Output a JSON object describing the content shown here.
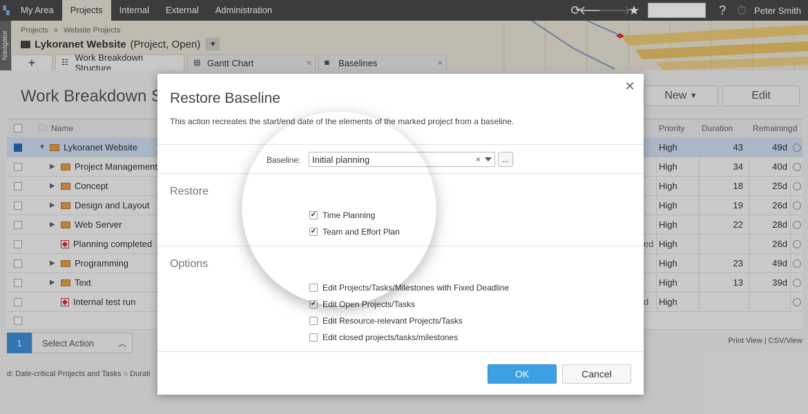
{
  "topnav": {
    "tabs": [
      "My Area",
      "Projects",
      "Internal",
      "External",
      "Administration"
    ],
    "active_tab": "Projects",
    "user": "Peter Smith",
    "icons": [
      "refresh-icon",
      "back-icon",
      "forward-icon",
      "star-icon",
      "help-icon",
      "timer-icon"
    ]
  },
  "project": {
    "navigator_label": "Navigator",
    "breadcrumb": [
      "Projects",
      "»",
      "Website Projects"
    ],
    "name": "Lykoranet Website",
    "status": "(Project, Open)",
    "view_tabs": [
      "Work Breakdown Structure",
      "Gantt Chart",
      "Baselines"
    ]
  },
  "page": {
    "title": "Work Breakdown S",
    "new_button": "New",
    "edit_button": "Edit",
    "columns": {
      "name": "Name",
      "priority": "Priority",
      "duration": "Duration",
      "remaining": "Remaining",
      "d": "d"
    },
    "rows": [
      {
        "name": "Lykoranet Website",
        "kind": "folder",
        "level": 0,
        "expanded": true,
        "priority": "High",
        "duration": "43",
        "remaining": "49d",
        "selected": true,
        "extra": ""
      },
      {
        "name": "Project Management",
        "kind": "folder",
        "level": 1,
        "priority": "High",
        "duration": "34",
        "remaining": "40d",
        "extra": ""
      },
      {
        "name": "Concept",
        "kind": "folder",
        "level": 1,
        "priority": "High",
        "duration": "18",
        "remaining": "25d",
        "extra": ""
      },
      {
        "name": "Design and Layout",
        "kind": "folder",
        "level": 1,
        "priority": "High",
        "duration": "19",
        "remaining": "26d",
        "extra": ""
      },
      {
        "name": "Web Server",
        "kind": "folder",
        "level": 1,
        "priority": "High",
        "duration": "22",
        "remaining": "28d",
        "extra": ""
      },
      {
        "name": "Planning completed",
        "kind": "milestone",
        "level": 1,
        "priority": "High",
        "duration": "",
        "remaining": "26d",
        "extra": "ed"
      },
      {
        "name": "Programming",
        "kind": "folder",
        "level": 1,
        "priority": "High",
        "duration": "23",
        "remaining": "49d",
        "extra": ""
      },
      {
        "name": "Text",
        "kind": "folder",
        "level": 1,
        "priority": "High",
        "duration": "13",
        "remaining": "39d",
        "extra": ""
      },
      {
        "name": "Internal test run",
        "kind": "milestone",
        "level": 1,
        "priority": "High",
        "duration": "",
        "remaining": "",
        "extra": "d"
      }
    ],
    "action_count": "1",
    "action_label": "Select Action",
    "print_links": "Print View | CSV/View",
    "legend": "d: Date-critical Projects and Tasks   ○ Durati"
  },
  "modal": {
    "title": "Restore Baseline",
    "description": "This action recreates the start/end date of the elements of the marked project from a baseline.",
    "baseline_label": "Baseline:",
    "baseline_value": "Initial planning",
    "baseline_clear": "×",
    "more_button": "...",
    "restore_heading": "Restore",
    "restore_items": [
      {
        "label": "Time Planning",
        "checked": true
      },
      {
        "label": "Team and Effort Plan",
        "checked": true
      }
    ],
    "options_heading": "Options",
    "option_items": [
      {
        "label": "Edit Projects/Tasks/Milestones with Fixed Deadline",
        "checked": false
      },
      {
        "label": "Edit Open Projects/Tasks",
        "checked": true
      },
      {
        "label": "Edit Resource-relevant Projects/Tasks",
        "checked": false
      },
      {
        "label": "Edit closed projects/tasks/milestones",
        "checked": false
      }
    ],
    "ok_label": "OK",
    "cancel_label": "Cancel"
  },
  "colors": {
    "accent": "#3ea0e4",
    "nav_bg": "#4a4a4a",
    "header_bg": "#e9e4d7",
    "selected_row": "#cfe0f2"
  }
}
